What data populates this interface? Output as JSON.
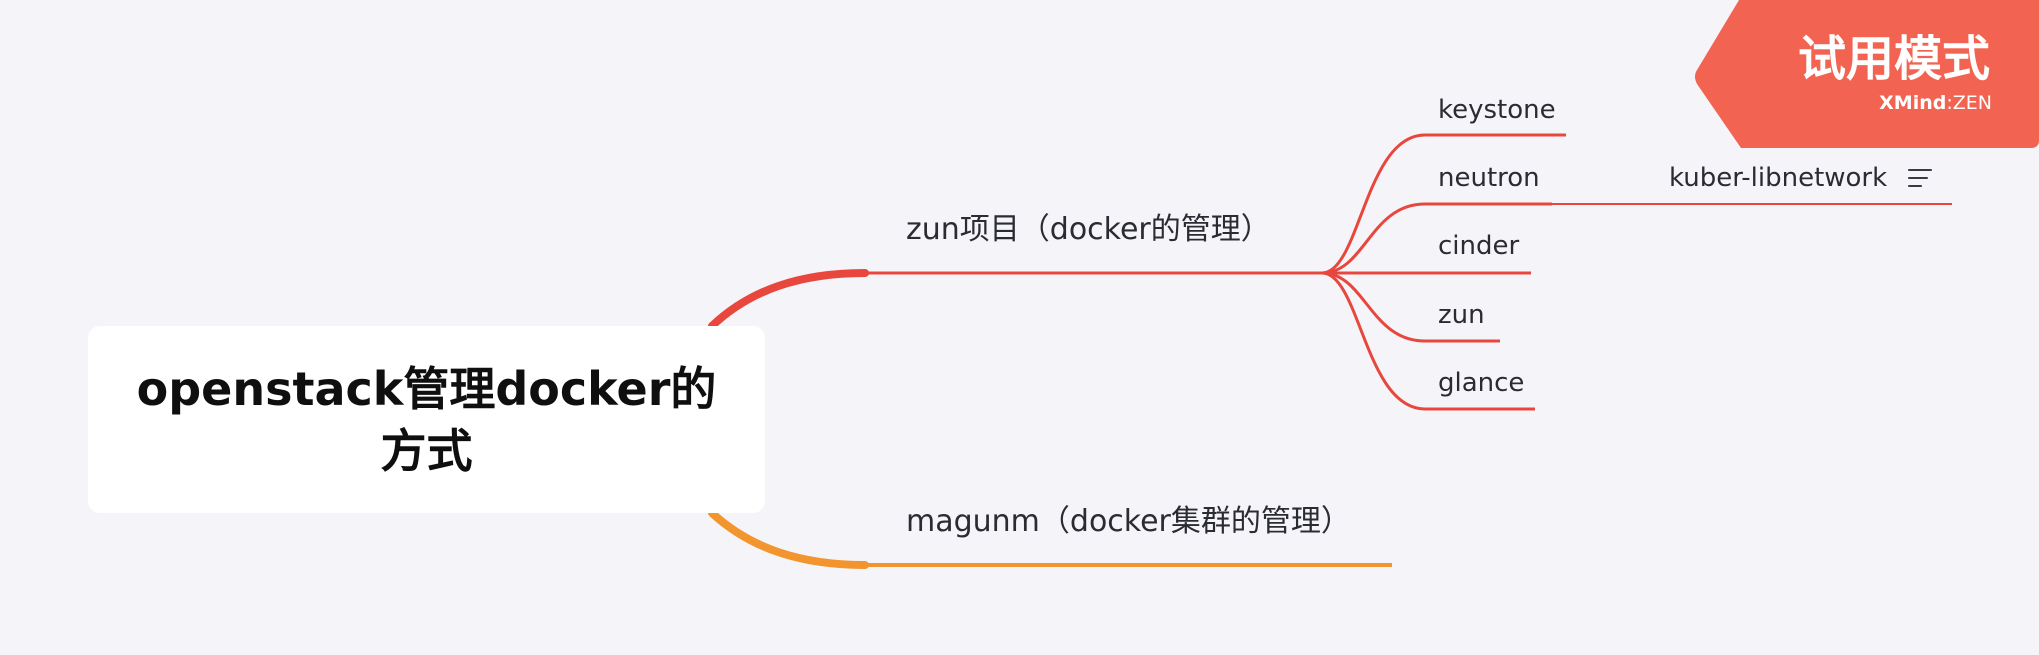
{
  "mindmap": {
    "root": {
      "label": "openstack管理docker的方式"
    },
    "branches": [
      {
        "label": "zun项目（docker的管理）",
        "color": "#e8473e",
        "children": [
          {
            "label": "keystone"
          },
          {
            "label": "neutron",
            "child": {
              "label": "kuber-libnetwork",
              "has_note": true
            }
          },
          {
            "label": "cinder"
          },
          {
            "label": "zun"
          },
          {
            "label": "glance"
          }
        ]
      },
      {
        "label": "magunm（docker集群的管理）",
        "color": "#f2952f",
        "children": []
      }
    ]
  },
  "trial_badge": {
    "text": "试用模式",
    "brand_bold": "XMind",
    "brand_sep": ":",
    "brand_light": "ZEN",
    "color": "#f26451"
  },
  "icons": {
    "note": "note-lines-icon"
  }
}
